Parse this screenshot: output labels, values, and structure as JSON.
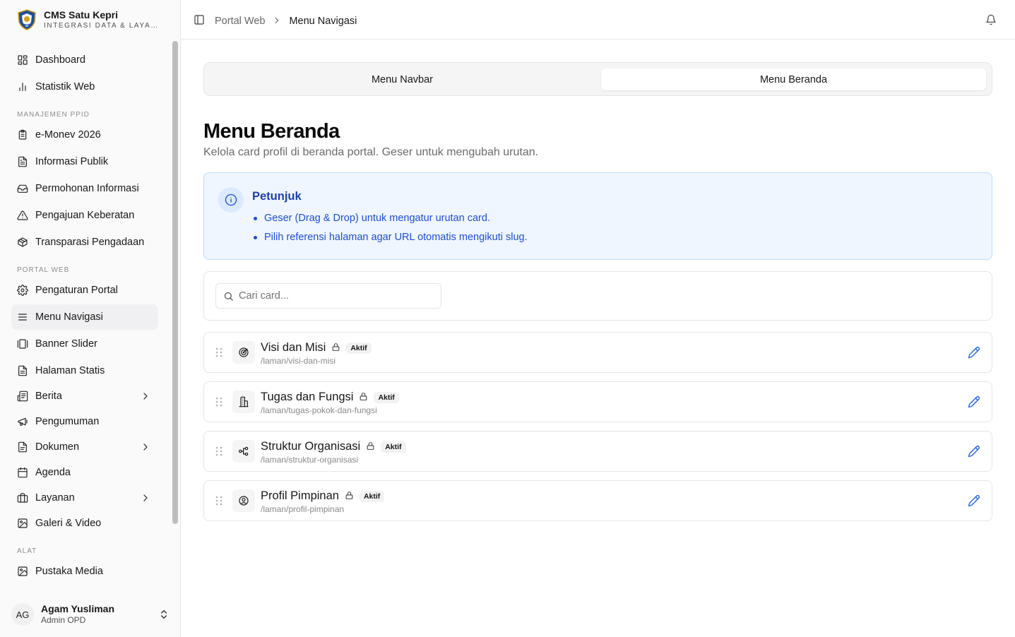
{
  "brand": {
    "title": "CMS Satu Kepri",
    "subtitle": "INTEGRASI DATA & LAYANAN"
  },
  "sidebar": {
    "items_top": [
      {
        "label": "Dashboard",
        "icon": "dashboard-icon"
      },
      {
        "label": "Statistik Web",
        "icon": "bar-chart-icon"
      }
    ],
    "section_ppid": "MANAJEMEN PPID",
    "items_ppid": [
      {
        "label": "e-Monev 2026",
        "icon": "clipboard-icon"
      },
      {
        "label": "Informasi Publik",
        "icon": "file-text-icon"
      },
      {
        "label": "Permohonan Informasi",
        "icon": "inbox-icon"
      },
      {
        "label": "Pengajuan Keberatan",
        "icon": "alert-triangle-icon"
      },
      {
        "label": "Transparasi Pengadaan",
        "icon": "package-icon"
      }
    ],
    "section_portal": "PORTAL WEB",
    "items_portal": [
      {
        "label": "Pengaturan Portal",
        "icon": "gear-icon"
      },
      {
        "label": "Menu Navigasi",
        "icon": "menu-icon",
        "active": true
      },
      {
        "label": "Banner Slider",
        "icon": "gallery-icon"
      },
      {
        "label": "Halaman Statis",
        "icon": "file-icon"
      },
      {
        "label": "Berita",
        "icon": "newspaper-icon",
        "expandable": true
      },
      {
        "label": "Pengumuman",
        "icon": "megaphone-icon"
      },
      {
        "label": "Dokumen",
        "icon": "folder-icon",
        "expandable": true
      },
      {
        "label": "Agenda",
        "icon": "calendar-icon"
      },
      {
        "label": "Layanan",
        "icon": "briefcase-icon",
        "expandable": true
      },
      {
        "label": "Galeri & Video",
        "icon": "image-icon"
      }
    ],
    "section_alat": "ALAT",
    "items_alat": [
      {
        "label": "Pustaka Media",
        "icon": "image-icon"
      }
    ]
  },
  "user": {
    "initials": "AG",
    "name": "Agam Yusliman",
    "role": "Admin OPD"
  },
  "header": {
    "breadcrumb_parent": "Portal Web",
    "breadcrumb_current": "Menu Navigasi"
  },
  "tabs": {
    "tab1": "Menu Navbar",
    "tab2": "Menu Beranda",
    "active": "tab2"
  },
  "main": {
    "title": "Menu Beranda",
    "subtitle": "Kelola card profil di beranda portal. Geser untuk mengubah urutan."
  },
  "info": {
    "title": "Petunjuk",
    "items": [
      "Geser (Drag & Drop) untuk mengatur urutan card.",
      "Pilih referensi halaman agar URL otomatis mengikuti slug."
    ]
  },
  "search": {
    "placeholder": "Cari card...",
    "value": ""
  },
  "cards": [
    {
      "title": "Visi dan Misi",
      "badge": "Aktif",
      "slug": "/laman/visi-dan-misi",
      "icon": "target-icon"
    },
    {
      "title": "Tugas dan Fungsi",
      "badge": "Aktif",
      "slug": "/laman/tugas-pokok-dan-fungsi",
      "icon": "building-icon"
    },
    {
      "title": "Struktur Organisasi",
      "badge": "Aktif",
      "slug": "/laman/struktur-organisasi",
      "icon": "org-chart-icon"
    },
    {
      "title": "Profil Pimpinan",
      "badge": "Aktif",
      "slug": "/laman/profil-pimpinan",
      "icon": "user-circle-icon"
    }
  ],
  "colors": {
    "accent_blue": "#2563eb",
    "info_bg": "#eff6ff",
    "info_border": "#bfdbfe",
    "info_text": "#1d4ed8"
  }
}
